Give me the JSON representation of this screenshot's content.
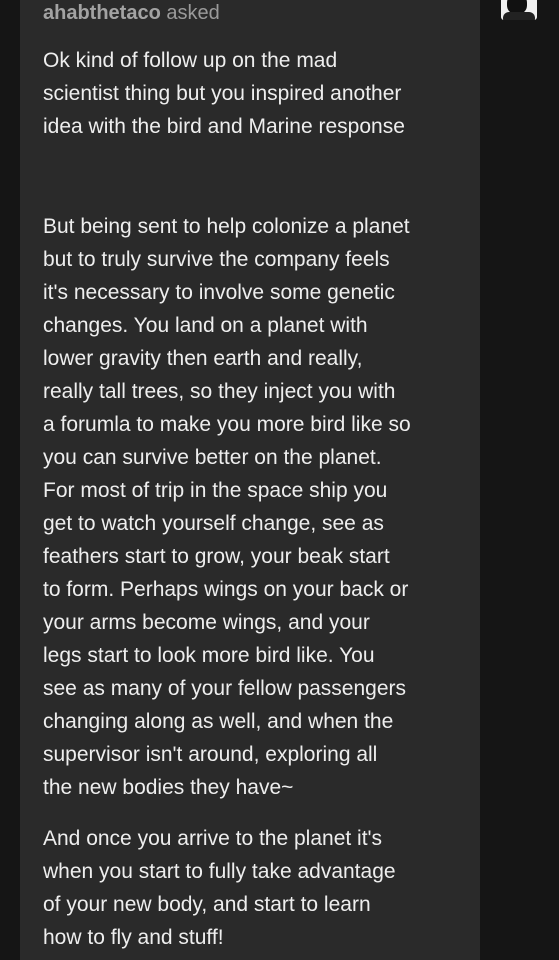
{
  "post": {
    "asker": "ahabthetaco",
    "asked_label": "asked",
    "paragraphs": [
      {
        "lines": [
          "Ok kind of follow up on the mad",
          "scientist thing but you inspired another",
          "idea with the bird and Marine response"
        ]
      },
      {
        "lines": [
          "But being sent to help colonize a planet",
          "but to truly survive the company feels",
          "it's necessary to involve some genetic",
          "changes. You land on a planet with",
          "lower gravity then earth and really,",
          "really tall trees, so they inject you with",
          "a forumla to make you more bird like so",
          "you can survive better on the planet.",
          "For most of trip in the space ship you",
          "get to watch yourself change, see as",
          "feathers start to grow, your beak start",
          "to form. Perhaps wings on your back or",
          "your arms become wings, and your",
          "legs start to look more bird like. You",
          "see as many of your fellow passengers",
          "changing along as well, and when the",
          "supervisor isn't around, exploring all",
          "the new bodies they have~"
        ]
      },
      {
        "lines": [
          "And once you arrive to the planet it's",
          "when you start to fully take advantage",
          "of your new body, and start to learn",
          "how to fly and stuff!"
        ]
      }
    ]
  }
}
